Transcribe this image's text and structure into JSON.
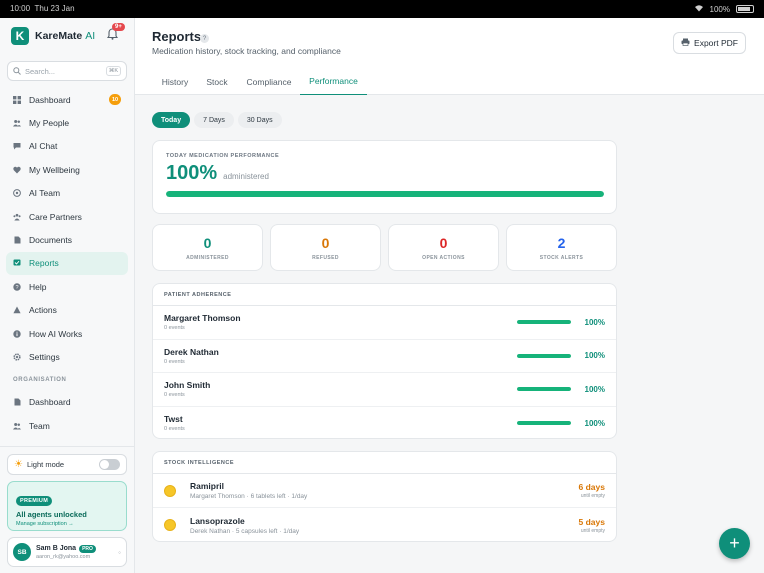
{
  "status_bar": {
    "time": "10:00",
    "date": "Thu 23 Jan",
    "battery": "100%"
  },
  "app": {
    "brand_name": "KareMate",
    "brand_suffix": "AI",
    "logo_letter": "K",
    "notification_badge": "9+"
  },
  "search": {
    "placeholder": "Search...",
    "shortcut": "⌘K"
  },
  "sidebar": {
    "items": [
      {
        "label": "Dashboard",
        "icon": "grid-icon",
        "badge": "10"
      },
      {
        "label": "My People",
        "icon": "people-icon"
      },
      {
        "label": "AI Chat",
        "icon": "chat-icon"
      },
      {
        "label": "My Wellbeing",
        "icon": "heart-icon"
      },
      {
        "label": "AI Team",
        "icon": "team-icon"
      },
      {
        "label": "Care Partners",
        "icon": "partners-icon"
      },
      {
        "label": "Documents",
        "icon": "document-icon"
      },
      {
        "label": "Reports",
        "icon": "reports-icon",
        "active": true
      },
      {
        "label": "Help",
        "icon": "help-icon"
      },
      {
        "label": "Actions",
        "icon": "warning-icon"
      },
      {
        "label": "How AI Works",
        "icon": "info-icon"
      },
      {
        "label": "Settings",
        "icon": "gear-icon"
      }
    ],
    "section_label": "ORGANISATION",
    "org_items": [
      {
        "label": "Dashboard",
        "icon": "org-dashboard-icon"
      },
      {
        "label": "Team",
        "icon": "org-team-icon"
      }
    ],
    "light_mode_label": "Light mode",
    "premium": {
      "pill": "PREMIUM",
      "title": "All agents unlocked",
      "link": "Manage subscription →"
    },
    "user": {
      "initials": "SB",
      "name": "Sam B Jona",
      "tier": "PRO",
      "email": "aaron_rk@yahoo.com"
    }
  },
  "header": {
    "title": "Reports",
    "help": "?",
    "subtitle": "Medication history, stock tracking, and compliance",
    "export_label": "Export PDF"
  },
  "tabs": [
    "History",
    "Stock",
    "Compliance",
    "Performance"
  ],
  "active_tab": "Performance",
  "range_chips": [
    "Today",
    "7 Days",
    "30 Days"
  ],
  "active_range": "Today",
  "performance": {
    "label": "TODAY MEDICATION PERFORMANCE",
    "value": "100%",
    "suffix": "administered",
    "progress_fraction": 1.0
  },
  "stats": [
    {
      "value": "0",
      "label": "ADMINISTERED",
      "color": "#0f8f7a"
    },
    {
      "value": "0",
      "label": "REFUSED",
      "color": "#d97706"
    },
    {
      "value": "0",
      "label": "OPEN ACTIONS",
      "color": "#dc2626"
    },
    {
      "value": "2",
      "label": "STOCK ALERTS",
      "color": "#2563eb"
    }
  ],
  "adherence": {
    "title": "PATIENT ADHERENCE",
    "rows": [
      {
        "name": "Margaret Thomson",
        "events": "0 events",
        "percent": "100%",
        "fraction": 1.0
      },
      {
        "name": "Derek Nathan",
        "events": "0 events",
        "percent": "100%",
        "fraction": 1.0
      },
      {
        "name": "John Smith",
        "events": "0 events",
        "percent": "100%",
        "fraction": 1.0
      },
      {
        "name": "Twst",
        "events": "0 events",
        "percent": "100%",
        "fraction": 1.0
      }
    ]
  },
  "stock": {
    "title": "STOCK INTELLIGENCE",
    "rows": [
      {
        "name": "Ramipril",
        "detail": "Margaret Thomson · 6 tablets left · 1/day",
        "days": "6 days",
        "until": "until empty"
      },
      {
        "name": "Lansoprazole",
        "detail": "Derek Nathan · 5 capsules left · 1/day",
        "days": "5 days",
        "until": "until empty"
      }
    ]
  },
  "fab_label": "+"
}
